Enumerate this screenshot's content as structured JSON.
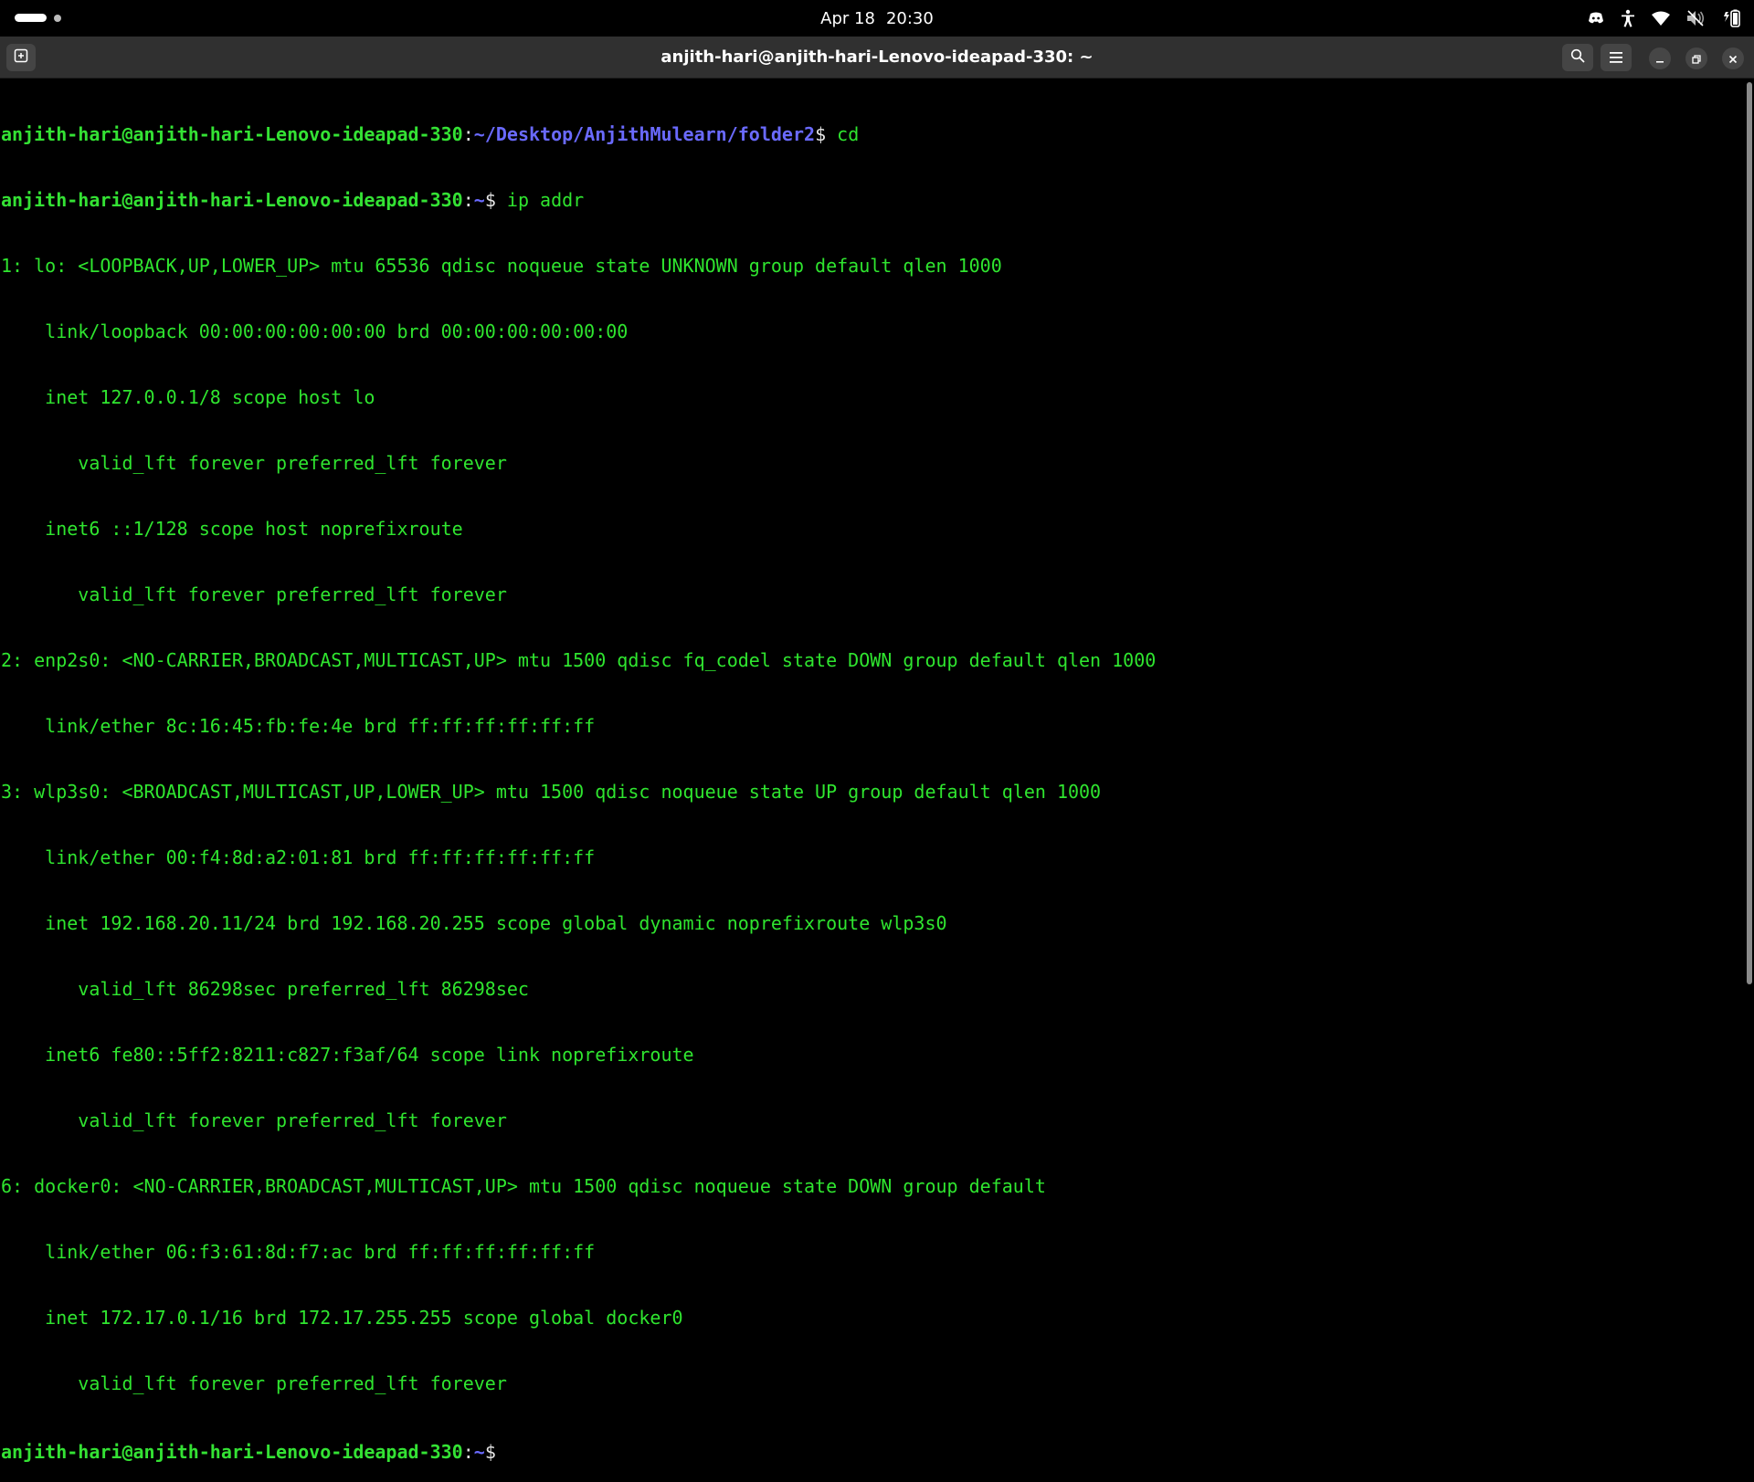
{
  "topbar": {
    "date": "Apr 18",
    "time": "20:30"
  },
  "window": {
    "title": "anjith-hari@anjith-hari-Lenovo-ideapad-330: ~"
  },
  "terminal": {
    "prompts": [
      {
        "user": "anjith-hari@anjith-hari-Lenovo-ideapad-330",
        "sep": ":",
        "path": "~/Desktop/AnjithMulearn/folder2",
        "dollar": "$",
        "command": " cd"
      },
      {
        "user": "anjith-hari@anjith-hari-Lenovo-ideapad-330",
        "sep": ":",
        "path": "~",
        "dollar": "$",
        "command": " ip addr"
      },
      {
        "user": "anjith-hari@anjith-hari-Lenovo-ideapad-330",
        "sep": ":",
        "path": "~",
        "dollar": "$",
        "command": ""
      }
    ],
    "output": [
      "1: lo: <LOOPBACK,UP,LOWER_UP> mtu 65536 qdisc noqueue state UNKNOWN group default qlen 1000",
      "    link/loopback 00:00:00:00:00:00 brd 00:00:00:00:00:00",
      "    inet 127.0.0.1/8 scope host lo",
      "       valid_lft forever preferred_lft forever",
      "    inet6 ::1/128 scope host noprefixroute",
      "       valid_lft forever preferred_lft forever",
      "2: enp2s0: <NO-CARRIER,BROADCAST,MULTICAST,UP> mtu 1500 qdisc fq_codel state DOWN group default qlen 1000",
      "    link/ether 8c:16:45:fb:fe:4e brd ff:ff:ff:ff:ff:ff",
      "3: wlp3s0: <BROADCAST,MULTICAST,UP,LOWER_UP> mtu 1500 qdisc noqueue state UP group default qlen 1000",
      "    link/ether 00:f4:8d:a2:01:81 brd ff:ff:ff:ff:ff:ff",
      "    inet 192.168.20.11/24 brd 192.168.20.255 scope global dynamic noprefixroute wlp3s0",
      "       valid_lft 86298sec preferred_lft 86298sec",
      "    inet6 fe80::5ff2:8211:c827:f3af/64 scope link noprefixroute",
      "       valid_lft forever preferred_lft forever",
      "6: docker0: <NO-CARRIER,BROADCAST,MULTICAST,UP> mtu 1500 qdisc noqueue state DOWN group default",
      "    link/ether 06:f3:61:8d:f7:ac brd ff:ff:ff:ff:ff:ff",
      "    inet 172.17.0.1/16 brd 172.17.255.255 scope global docker0",
      "       valid_lft forever preferred_lft forever"
    ]
  },
  "icons": {
    "tray": [
      "discord-icon",
      "accessibility-icon",
      "wifi-icon",
      "volume-muted-icon",
      "battery-icon"
    ],
    "titlebar": [
      "new-tab-icon",
      "search-icon",
      "menu-icon",
      "minimize-icon",
      "maximize-icon",
      "close-icon"
    ]
  },
  "colors": {
    "prompt_user": "#34e234",
    "prompt_path": "#6a6aff",
    "output_text": "#2fe52f",
    "terminal_bg": "#000000",
    "titlebar_bg": "#303030"
  }
}
